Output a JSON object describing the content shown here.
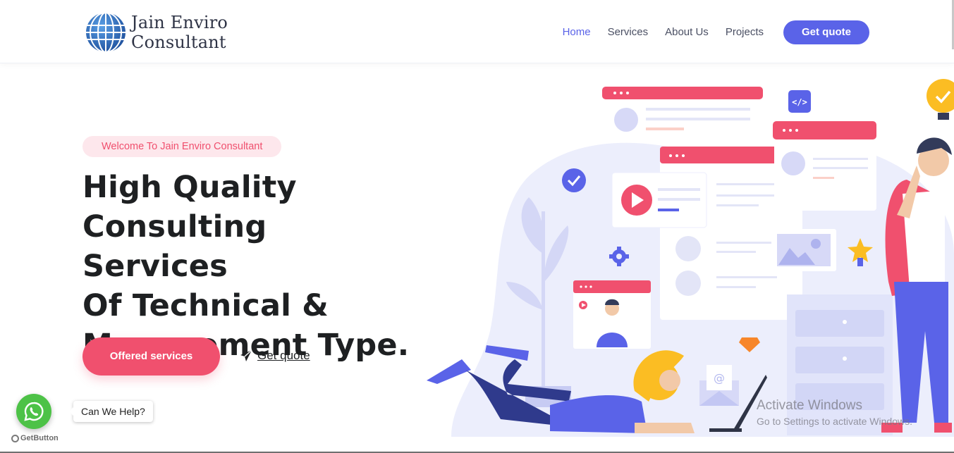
{
  "brand": {
    "name_line1": "Jain Enviro",
    "name_line2": "Consultant",
    "logo_icon": "globe-icon"
  },
  "nav": {
    "items": [
      {
        "label": "Home",
        "active": true
      },
      {
        "label": "Services",
        "active": false
      },
      {
        "label": "About Us",
        "active": false
      },
      {
        "label": "Projects",
        "active": false
      }
    ],
    "cta_label": "Get quote"
  },
  "hero": {
    "badge": "Welcome To Jain Enviro Consultant",
    "title_lines": [
      "High Quality",
      "Consulting Services",
      "Of Technical &",
      "Management Type."
    ],
    "primary_button": "Offered services",
    "secondary_link": "Get quote",
    "secondary_icon": "paper-plane-icon"
  },
  "widget": {
    "icon": "whatsapp-icon",
    "tooltip": "Can We Help?",
    "credit": "GetButton"
  },
  "watermark": {
    "line1": "Activate Windows",
    "line2": "Go to Settings to activate Windows."
  },
  "colors": {
    "accent": "#5a63e8",
    "pink": "#f0506e",
    "badge_bg": "#fde7ec",
    "whatsapp": "#4dc247"
  }
}
